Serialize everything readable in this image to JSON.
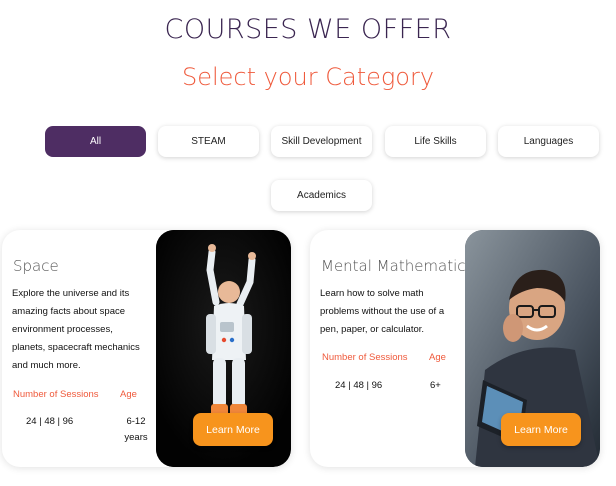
{
  "header": {
    "title": "COURSES WE OFFER",
    "subtitle": "Select your Category"
  },
  "tabs": [
    {
      "label": "All",
      "active": true
    },
    {
      "label": "STEAM",
      "active": false
    },
    {
      "label": "Skill Development",
      "active": false
    },
    {
      "label": "Life Skills",
      "active": false
    },
    {
      "label": "Languages",
      "active": false
    },
    {
      "label": "Academics",
      "active": false
    }
  ],
  "courses": [
    {
      "title": "Space",
      "description": "Explore the universe and its amazing facts about space environment processes, planets, spacecraft mechanics and much more.",
      "sessions_label": "Number of Sessions",
      "sessions": "24 | 48 | 96",
      "age_label": "Age",
      "age": "6-12 years",
      "button": "Learn More",
      "image": "child-astronaut-photo"
    },
    {
      "title": "Mental Mathematics",
      "description": "Learn how to solve math problems without the use of a pen, paper, or calculator.",
      "sessions_label": "Number of Sessions",
      "sessions": "24 | 48 | 96",
      "age_label": "Age",
      "age": "6+",
      "button": "Learn More",
      "image": "boy-with-laptop-photo"
    }
  ],
  "colors": {
    "accent": "#4e2d63",
    "highlight": "#ef5a3c",
    "button": "#f7941d"
  }
}
